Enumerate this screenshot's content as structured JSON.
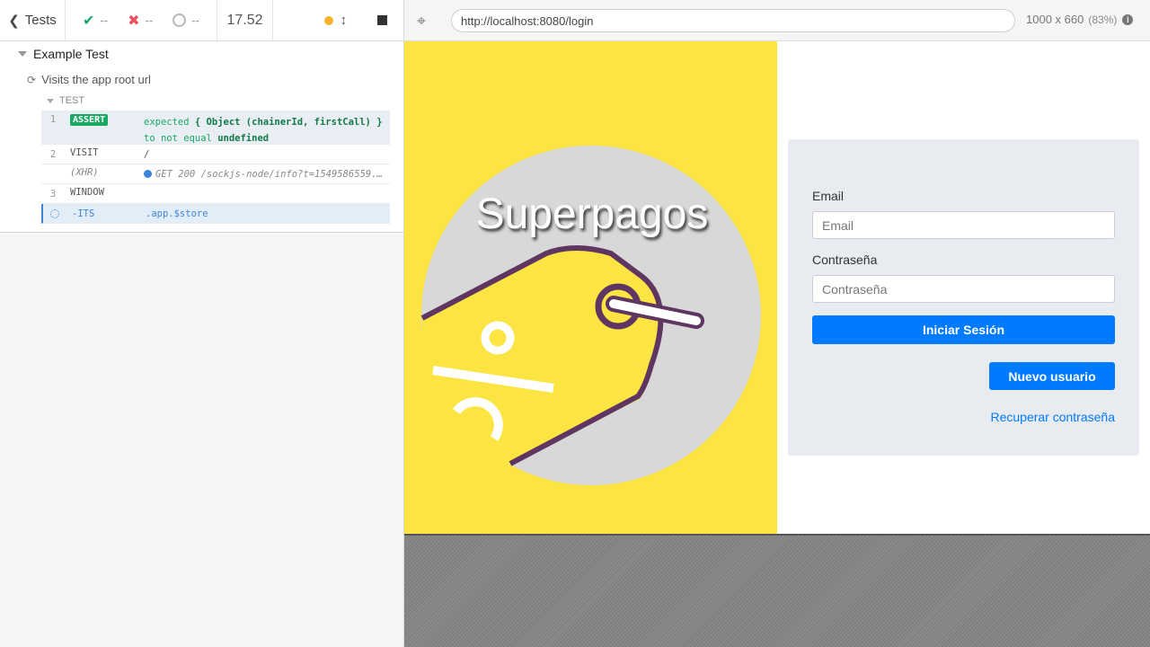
{
  "reporter": {
    "tests_label": "Tests",
    "passed": "--",
    "failed": "--",
    "pending": "--",
    "duration": "17.52",
    "suite_title": "Example Test",
    "test_title": "Visits the app root url",
    "hook_title": "TEST",
    "commands": [
      {
        "num": "1",
        "name": "ASSERT",
        "message_parts": [
          "expected",
          "{ Object (chainerId, firstCall)",
          "}",
          "to not equal",
          "undefined"
        ]
      },
      {
        "num": "2",
        "name": "VISIT",
        "message": "/"
      },
      {
        "num": "",
        "name": "(XHR)",
        "message": "GET 200 /sockjs-node/info?t=1549586559..."
      },
      {
        "num": "3",
        "name": "WINDOW",
        "message": ""
      },
      {
        "num": "",
        "name": "-ITS",
        "message": ".app.$store"
      }
    ]
  },
  "aut": {
    "url": "http://localhost:8080/login",
    "viewport": "1000 x 660",
    "scale": "(83%)"
  },
  "app": {
    "brand": "Superpagos",
    "email_label": "Email",
    "email_placeholder": "Email",
    "password_label": "Contraseña",
    "password_placeholder": "Contraseña",
    "login_button": "Iniciar Sesión",
    "new_user_button": "Nuevo usuario",
    "recover_link": "Recuperar contraseña"
  },
  "colors": {
    "pass": "#1aa863",
    "fail": "#e94f5f",
    "brand_yellow": "#fce443",
    "primary": "#007bff"
  }
}
